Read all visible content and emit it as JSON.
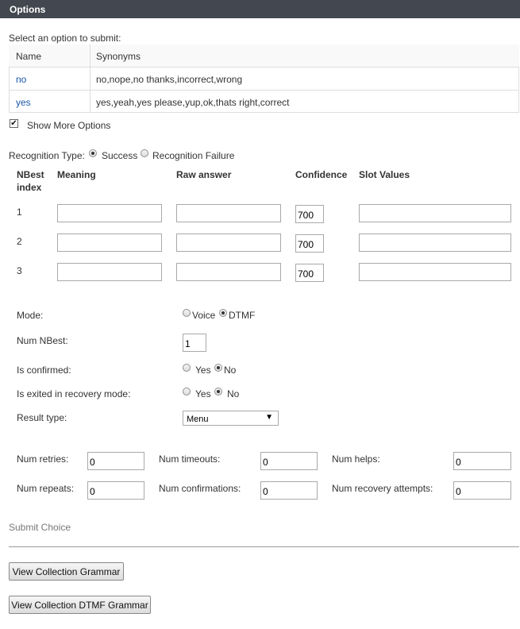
{
  "header": {
    "title": "Options"
  },
  "select_prompt": "Select an option to submit:",
  "options_table": {
    "columns": [
      "Name",
      "Synonyms"
    ],
    "rows": [
      {
        "name": "no",
        "synonyms": "no,nope,no thanks,incorrect,wrong"
      },
      {
        "name": "yes",
        "synonyms": "yes,yeah,yes please,yup,ok,thats right,correct"
      }
    ]
  },
  "show_more": {
    "label": "Show More Options",
    "checked": true
  },
  "recognition": {
    "label": "Recognition Type:",
    "options": [
      "Success",
      "Recognition Failure"
    ],
    "selected": "Success"
  },
  "nbest_table": {
    "headers": {
      "index_line1": "NBest",
      "index_line2": "index",
      "meaning": "Meaning",
      "raw": "Raw answer",
      "confidence": "Confidence",
      "slots": "Slot Values"
    },
    "rows": [
      {
        "index": "1",
        "meaning": "",
        "raw": "",
        "confidence": "700",
        "slots": ""
      },
      {
        "index": "2",
        "meaning": "",
        "raw": "",
        "confidence": "700",
        "slots": ""
      },
      {
        "index": "3",
        "meaning": "",
        "raw": "",
        "confidence": "700",
        "slots": ""
      }
    ]
  },
  "settings": {
    "mode": {
      "label": "Mode:",
      "options": [
        "Voice",
        "DTMF"
      ],
      "selected": "DTMF"
    },
    "num_nbest": {
      "label": "Num NBest:",
      "value": "1"
    },
    "is_confirmed": {
      "label": "Is confirmed:",
      "options": [
        "Yes",
        "No"
      ],
      "selected": "No"
    },
    "is_exited": {
      "label": "Is exited in recovery mode:",
      "options": [
        "Yes",
        "No"
      ],
      "selected": "No"
    },
    "result_type": {
      "label": "Result type:",
      "value": "Menu"
    }
  },
  "counters": {
    "num_retries": {
      "label": "Num retries:",
      "value": "0"
    },
    "num_timeouts": {
      "label": "Num timeouts:",
      "value": "0"
    },
    "num_helps": {
      "label": "Num helps:",
      "value": "0"
    },
    "num_repeats": {
      "label": "Num repeats:",
      "value": "0"
    },
    "num_confirmations": {
      "label": "Num confirmations:",
      "value": "0"
    },
    "num_recovery_attempts": {
      "label": "Num recovery attempts:",
      "value": "0"
    }
  },
  "submit_label": "Submit Choice",
  "buttons": {
    "view_grammar": "View Collection Grammar",
    "view_dtmf_grammar": "View Collection DTMF Grammar"
  }
}
